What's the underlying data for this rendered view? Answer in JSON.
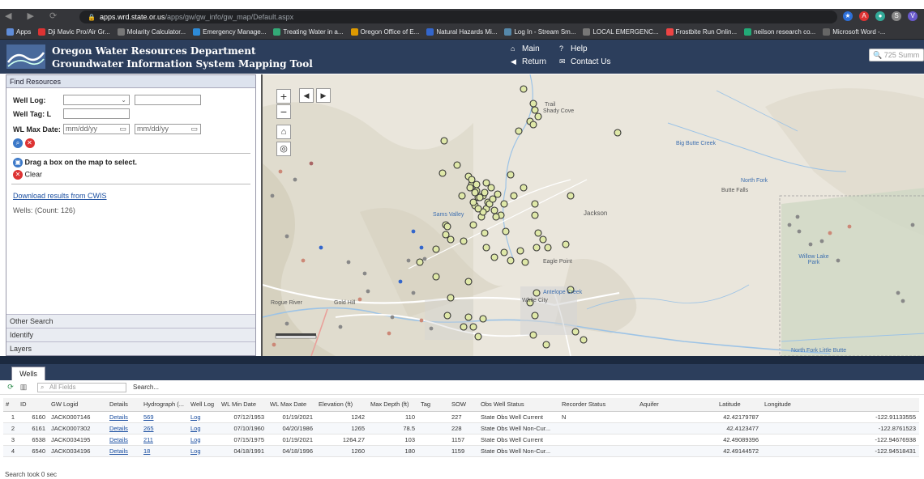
{
  "browser": {
    "url_domain": "apps.wrd.state.or.us",
    "url_path": "/apps/gw/gw_info/gw_map/Default.aspx",
    "bookmarks": [
      {
        "label": "Apps",
        "color": "#5f8cd8"
      },
      {
        "label": "Dji Mavic Pro/Air Gr...",
        "color": "#d33"
      },
      {
        "label": "Molarity Calculator...",
        "color": "#777"
      },
      {
        "label": "Emergency Manage...",
        "color": "#2d8bd8"
      },
      {
        "label": "Treating Water in a...",
        "color": "#3a7"
      },
      {
        "label": "Oregon Office of E...",
        "color": "#d90"
      },
      {
        "label": "Natural Hazards Mi...",
        "color": "#36c"
      },
      {
        "label": "Log In - Stream Sm...",
        "color": "#58a"
      },
      {
        "label": "LOCAL EMERGENC...",
        "color": "#777"
      },
      {
        "label": "Frostbite Run Onlin...",
        "color": "#e44"
      },
      {
        "label": "neilson research co...",
        "color": "#2a7"
      },
      {
        "label": "Microsoft Word -...",
        "color": "#666"
      }
    ]
  },
  "header": {
    "title_line1": "Oregon Water Resources Department",
    "title_line2": "Groundwater Information System Mapping Tool",
    "links": {
      "main": "Main",
      "help": "Help",
      "return": "Return",
      "contact": "Contact Us"
    },
    "search_placeholder": "725 Summ"
  },
  "find_resources": {
    "title": "Find Resources",
    "well_log_label": "Well Log:",
    "well_tag_label": "Well Tag: L",
    "wl_max_date_label": "WL Max Date:",
    "date_placeholder": "mm/dd/yy",
    "drag_box_text": "Drag a box on the map to select.",
    "clear_label": "Clear",
    "download_link": "Download results from CWIS",
    "wells_count": "Wells: (Count: 126)"
  },
  "accordion": {
    "other_search": "Other Search",
    "identify": "Identify",
    "layers": "Layers"
  },
  "map": {
    "labels": {
      "jackson": "Jackson",
      "eagle_point": "Eagle Point",
      "butte_falls": "Butte Falls",
      "white_city": "White City",
      "gold_hill": "Gold Hill",
      "willow_lake": "Willow Lake Park",
      "rogue_river": "Rogue River",
      "north_fork": "North Fork",
      "big_butte": "Big Butte Creek",
      "trail": "Trail",
      "shady_cove": "Shady Cove",
      "antelope": "Antelope Creek",
      "sams_valley": "Sams Valley",
      "little_butte": "North Fork Little Butte"
    }
  },
  "wells_panel": {
    "tab_label": "Wells",
    "search_placeholder": "All Fields",
    "search_button": "Search...",
    "columns": [
      "#",
      "ID",
      "GW Logid",
      "Details",
      "Hydrograph (...",
      "Well Log",
      "WL Min Date",
      "WL Max Date",
      "Elevation (ft)",
      "Max Depth (ft)",
      "Tag",
      "SOW",
      "Obs Well Status",
      "Recorder Status",
      "Aquifer",
      "Latitude",
      "Longitude"
    ],
    "rows": [
      [
        "1",
        "6160",
        "JACK0007146",
        "Details",
        "569",
        "Log",
        "07/12/1953",
        "01/19/2021",
        "1242",
        "110",
        "",
        "227",
        "State Obs Well Current",
        "N",
        "",
        "42.42179787",
        "-122.91133555"
      ],
      [
        "2",
        "6161",
        "JACK0007302",
        "Details",
        "265",
        "Log",
        "07/10/1960",
        "04/20/1986",
        "1265",
        "78.5",
        "",
        "228",
        "State Obs Well Non-Cur...",
        "",
        "",
        "42.4123477",
        "-122.8761523"
      ],
      [
        "3",
        "6538",
        "JACK0034195",
        "Details",
        "211",
        "Log",
        "07/15/1975",
        "01/19/2021",
        "1264.27",
        "103",
        "",
        "1157",
        "State Obs Well Current",
        "",
        "",
        "42.49089396",
        "-122.94676938"
      ],
      [
        "4",
        "6540",
        "JACK0034196",
        "Details",
        "18",
        "Log",
        "04/18/1991",
        "04/18/1996",
        "1260",
        "180",
        "",
        "1159",
        "State Obs Well Non-Cur...",
        "",
        "",
        "42.49144572",
        "-122.94518431"
      ]
    ],
    "status": "Search took 0 sec"
  }
}
